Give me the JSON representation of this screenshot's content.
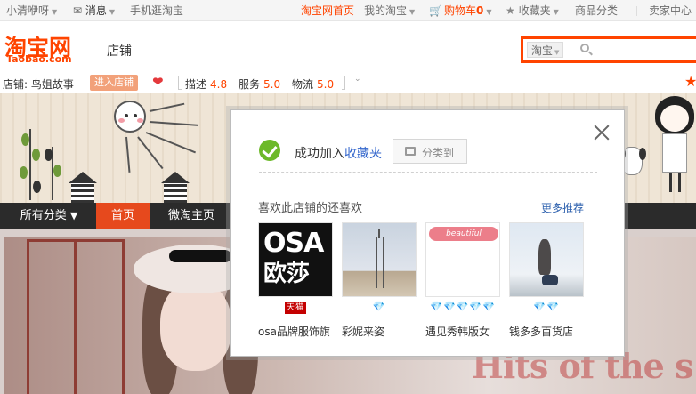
{
  "topbar": {
    "user": "小清咿呀",
    "messages": "消息",
    "mobile": "手机逛淘宝",
    "home": "淘宝网首页",
    "my_taobao": "我的淘宝",
    "cart": "购物车",
    "cart_count": "0",
    "favorites": "收藏夹",
    "categories": "商品分类",
    "seller_center": "卖家中心"
  },
  "header": {
    "logo_cn": "淘宝网",
    "logo_en": "Taobao.com",
    "section": "店铺",
    "search_scope": "淘宝"
  },
  "shop": {
    "label": "店铺:",
    "name": "鸟姐故事",
    "enter_button": "进入店铺",
    "ratings": [
      {
        "label": "描述",
        "value": "4.8"
      },
      {
        "label": "服务",
        "value": "5.0"
      },
      {
        "label": "物流",
        "value": "5.0"
      }
    ]
  },
  "nav": {
    "all_categories": "所有分类",
    "home": "首页",
    "weitao": "微淘主页"
  },
  "banner_text": "Hits of the s",
  "popup": {
    "success_text": "成功加入",
    "success_link": "收藏夹",
    "category_button": "分类到",
    "like_title": "喜欢此店铺的还喜欢",
    "more_link": "更多推荐",
    "items": [
      {
        "name": "osa品牌服饰旗",
        "thumb_line1": "OSA",
        "thumb_line2": "欧莎",
        "badge": "天猫",
        "diamonds": ""
      },
      {
        "name": "彩妮来姿",
        "badge": "",
        "diamonds": "💎"
      },
      {
        "name": "遇见秀韩版女",
        "thumb_logo": "beautiful",
        "badge": "",
        "diamonds": "💎💎💎💎💎"
      },
      {
        "name": "钱多多百货店",
        "badge": "",
        "diamonds": "💎💎"
      }
    ]
  },
  "colors": {
    "brand": "#ff4400",
    "nav_active": "#e6491d",
    "success": "#6cb929",
    "link": "#3366cc"
  }
}
